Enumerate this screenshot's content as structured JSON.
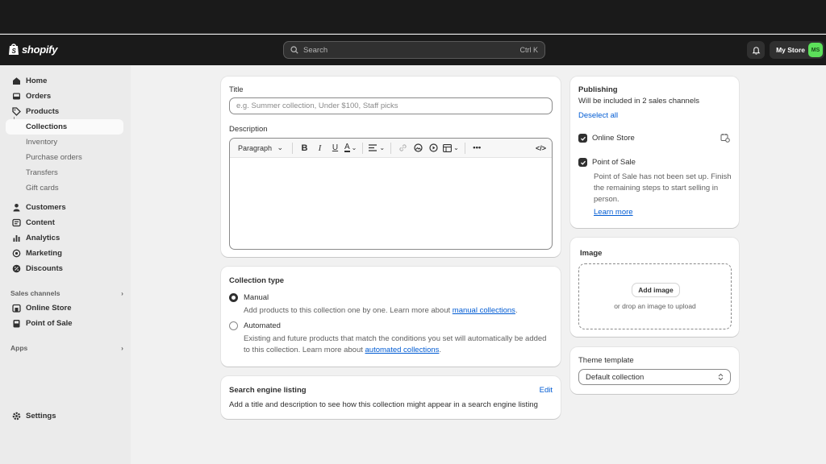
{
  "app": {
    "logo_text": "shopify"
  },
  "search": {
    "placeholder": "Search",
    "shortcut": "Ctrl K"
  },
  "store": {
    "name": "My Store",
    "avatar_initials": "MS",
    "avatar_color": "#5ce05a"
  },
  "sidebar": {
    "items": [
      {
        "label": "Home",
        "icon": "home-icon"
      },
      {
        "label": "Orders",
        "icon": "inbox-icon"
      },
      {
        "label": "Products",
        "icon": "tag-icon"
      }
    ],
    "product_sub": [
      "Collections",
      "Inventory",
      "Purchase orders",
      "Transfers",
      "Gift cards"
    ],
    "items2": [
      {
        "label": "Customers",
        "icon": "person-icon"
      },
      {
        "label": "Content",
        "icon": "content-icon"
      },
      {
        "label": "Analytics",
        "icon": "bar-chart-icon"
      },
      {
        "label": "Marketing",
        "icon": "target-icon"
      },
      {
        "label": "Discounts",
        "icon": "discount-icon"
      }
    ],
    "sales_channels_label": "Sales channels",
    "channels": [
      {
        "label": "Online Store",
        "icon": "store-icon"
      },
      {
        "label": "Point of Sale",
        "icon": "pos-icon"
      }
    ],
    "apps_label": "Apps",
    "settings_label": "Settings"
  },
  "main": {
    "title_label": "Title",
    "title_placeholder": "e.g. Summer collection, Under $100, Staff picks",
    "description_label": "Description",
    "editor_format": "Paragraph",
    "collection_type": {
      "heading": "Collection type",
      "manual_label": "Manual",
      "manual_desc": "Add products to this collection one by one. Learn more about ",
      "manual_link": "manual collections",
      "automated_label": "Automated",
      "automated_desc_1": "Existing and future products that match the conditions you set will automatically be added",
      "automated_desc_2": "to this collection. Learn more about ",
      "automated_link": "automated collections",
      "selected": "Manual"
    },
    "seo": {
      "heading": "Search engine listing",
      "edit_label": "Edit",
      "desc": "Add a title and description to see how this collection might appear in a search engine listing"
    }
  },
  "right": {
    "publishing": {
      "heading": "Publishing",
      "subtitle": "Will be included in 2 sales channels",
      "deselect": "Deselect all",
      "online_store": "Online Store",
      "pos": "Point of Sale",
      "pos_note_1": "Point of Sale has not been set up. Finish",
      "pos_note_2": "the remaining steps to start selling in",
      "pos_note_3": "person.",
      "learn_more": "Learn more"
    },
    "image": {
      "heading": "Image",
      "add_button": "Add image",
      "drop_text": "or drop an image to upload"
    },
    "theme": {
      "heading": "Theme template",
      "selected": "Default collection"
    }
  }
}
